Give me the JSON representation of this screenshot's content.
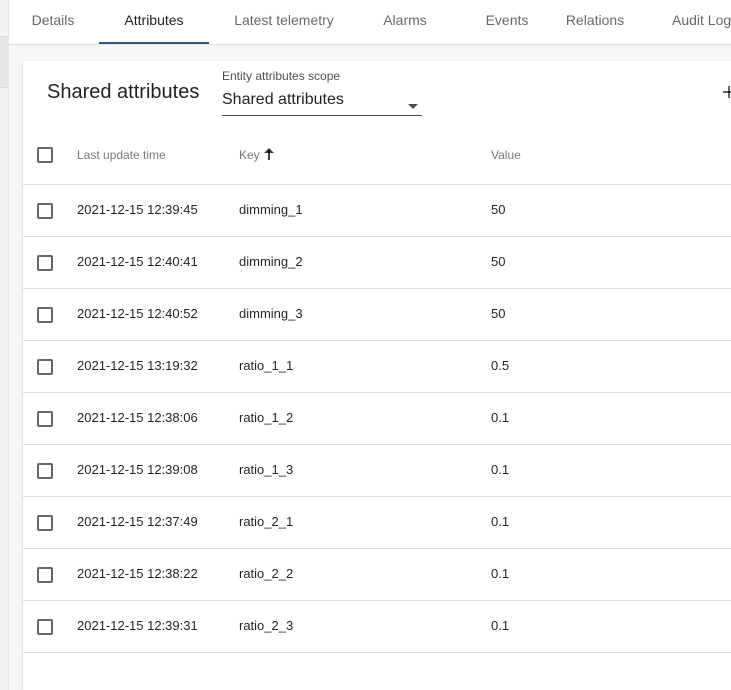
{
  "tabs": [
    {
      "label": "Details"
    },
    {
      "label": "Attributes"
    },
    {
      "label": "Latest telemetry"
    },
    {
      "label": "Alarms"
    },
    {
      "label": "Events"
    },
    {
      "label": "Relations"
    },
    {
      "label": "Audit Logs"
    }
  ],
  "active_tab": "Attributes",
  "card": {
    "title": "Shared attributes",
    "scope_label": "Entity attributes scope",
    "scope_value": "Shared attributes",
    "add_icon": "add-icon"
  },
  "table": {
    "headers": {
      "time": "Last update time",
      "key": "Key",
      "value": "Value"
    },
    "sort": {
      "column": "Key",
      "direction": "ascending",
      "icon": "arrow-up-icon"
    },
    "rows": [
      {
        "time": "2021-12-15 12:39:45",
        "key": "dimming_1",
        "value": "50"
      },
      {
        "time": "2021-12-15 12:40:41",
        "key": "dimming_2",
        "value": "50"
      },
      {
        "time": "2021-12-15 12:40:52",
        "key": "dimming_3",
        "value": "50"
      },
      {
        "time": "2021-12-15 13:19:32",
        "key": "ratio_1_1",
        "value": "0.5"
      },
      {
        "time": "2021-12-15 12:38:06",
        "key": "ratio_1_2",
        "value": "0.1"
      },
      {
        "time": "2021-12-15 12:39:08",
        "key": "ratio_1_3",
        "value": "0.1"
      },
      {
        "time": "2021-12-15 12:37:49",
        "key": "ratio_2_1",
        "value": "0.1"
      },
      {
        "time": "2021-12-15 12:38:22",
        "key": "ratio_2_2",
        "value": "0.1"
      },
      {
        "time": "2021-12-15 12:39:31",
        "key": "ratio_2_3",
        "value": "0.1"
      }
    ]
  },
  "colors": {
    "tab_ink": "#305680",
    "divider": "#e0e0e0"
  }
}
